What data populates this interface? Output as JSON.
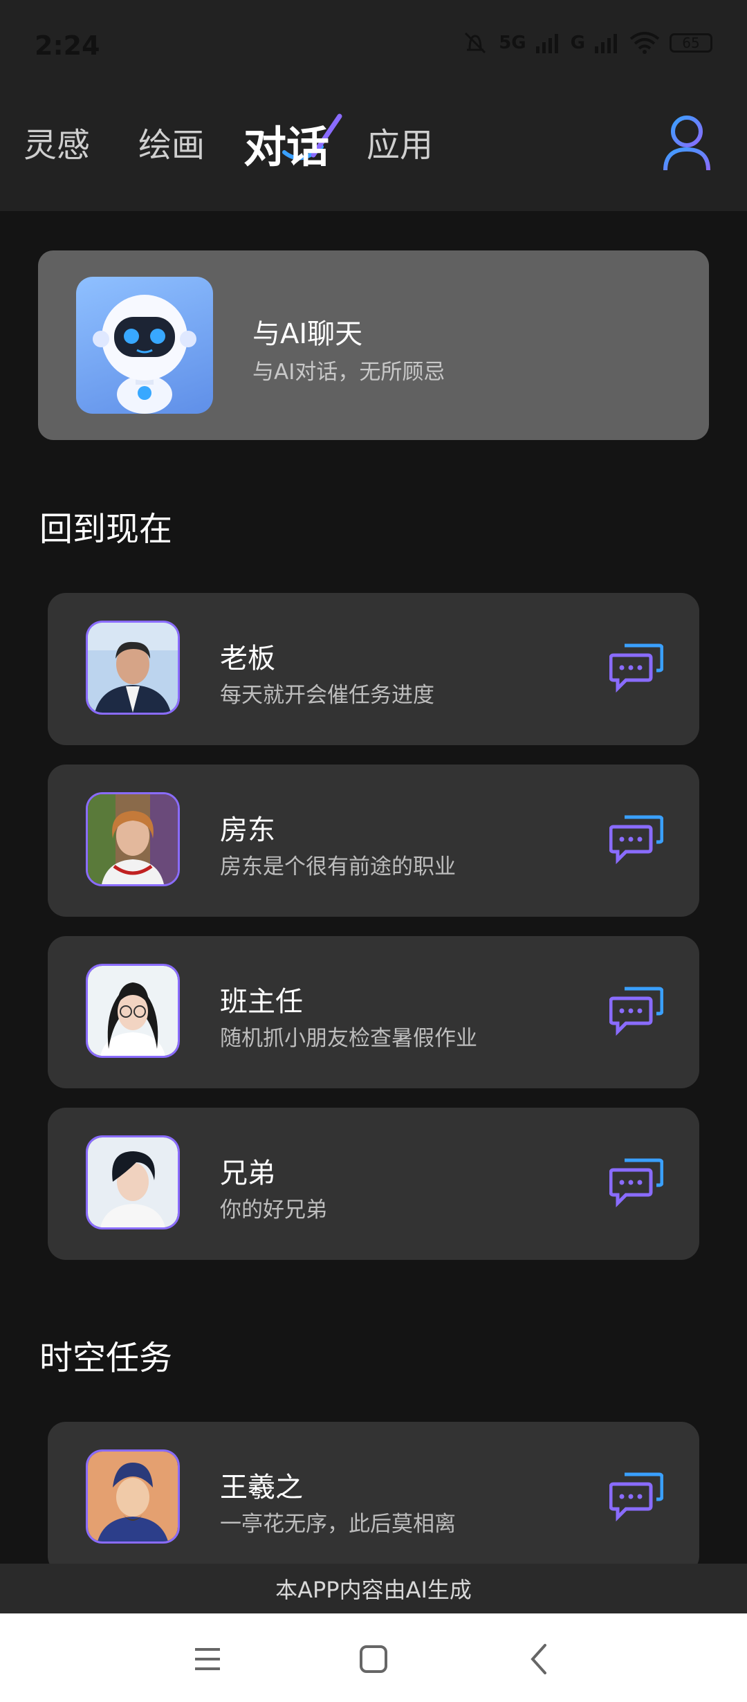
{
  "status_bar": {
    "time": "2:24",
    "network_1": "5G",
    "network_2": "G",
    "battery": "65"
  },
  "tabs": [
    {
      "label": "灵感",
      "active": false
    },
    {
      "label": "绘画",
      "active": false
    },
    {
      "label": "对话",
      "active": true
    },
    {
      "label": "应用",
      "active": false
    }
  ],
  "ai_card": {
    "title": "与AI聊天",
    "subtitle": "与AI对话，无所顾忌"
  },
  "sections": [
    {
      "title": "回到现在",
      "items": [
        {
          "name": "老板",
          "desc": "每天就开会催任务进度"
        },
        {
          "name": "房东",
          "desc": "房东是个很有前途的职业"
        },
        {
          "name": "班主任",
          "desc": "随机抓小朋友检查暑假作业"
        },
        {
          "name": "兄弟",
          "desc": "你的好兄弟"
        }
      ]
    },
    {
      "title": "时空任务",
      "items": [
        {
          "name": "王羲之",
          "desc": "一亭花无序，此后莫相离"
        }
      ]
    }
  ],
  "footer_note": "本APP内容由AI生成",
  "colors": {
    "accent": "#8a6cff",
    "accent_blue": "#3aa0ff",
    "card": "#333333"
  },
  "icons": {
    "user": "user-icon",
    "chat": "chat-bubbles-icon",
    "menu": "menu-icon",
    "home": "home-icon",
    "back": "back-icon"
  }
}
